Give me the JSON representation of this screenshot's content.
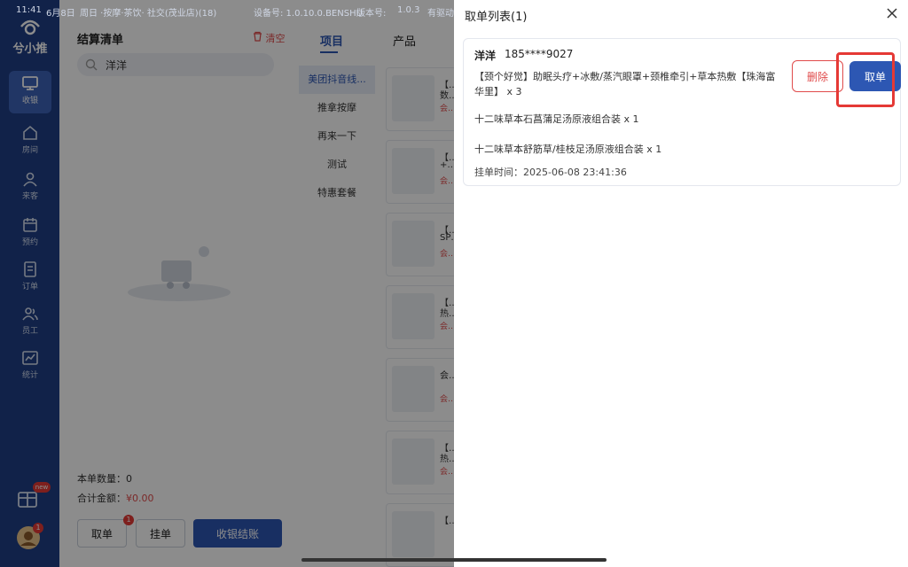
{
  "status_bar": {
    "time": "11:41",
    "date": "6月8日",
    "store": "周日 ·按摩·茶饮· 社交(茂业店)(18)",
    "device": "设备号: 1.0.10.0.BENSHU",
    "version_label": "版本号:",
    "version": "1.0.3",
    "extra": "有驱动"
  },
  "sidebar": {
    "logo_text": "兮小推",
    "items": [
      {
        "label": "收银",
        "icon": "monitor-icon"
      },
      {
        "label": "房间",
        "icon": "home-icon"
      },
      {
        "label": "来客",
        "icon": "user-icon"
      },
      {
        "label": "预约",
        "icon": "calendar-icon"
      },
      {
        "label": "订单",
        "icon": "document-icon"
      },
      {
        "label": "员工",
        "icon": "users-icon"
      },
      {
        "label": "统计",
        "icon": "chart-icon"
      }
    ],
    "promo_badge": "new",
    "avatar_badge": "1"
  },
  "left_panel": {
    "title": "结算清单",
    "clear_label": "清空",
    "search_value": "洋洋",
    "item_count_label": "本单数量：",
    "item_count": "0",
    "total_label": "合计金额：",
    "total_amount": "¥0.00",
    "btn_take": "取单",
    "btn_take_badge": "1",
    "btn_hold": "挂单",
    "btn_checkout": "收银结账"
  },
  "middle_panel": {
    "tabs": [
      "项目",
      "产品"
    ],
    "categories": [
      "美团抖音线...",
      "推拿按摩",
      "再来一下",
      "测试",
      "特惠套餐"
    ],
    "products": [
      {
        "line": "【…",
        "line2": "数…",
        "tag": "会…"
      },
      {
        "line": "【…",
        "line2": "+…",
        "tag": "会…"
      },
      {
        "line": "【…",
        "line2": "SP…",
        "tag": "会…"
      },
      {
        "line": "【…",
        "line2": "热…",
        "tag": "会…"
      },
      {
        "line": "会…",
        "line2": "",
        "tag": "会…"
      },
      {
        "line": "【…",
        "line2": "热…",
        "tag": "会…"
      },
      {
        "line": "【…",
        "line2": "",
        "tag": ""
      }
    ]
  },
  "take_order_panel": {
    "title": "取单列表(1)",
    "order": {
      "name": "洋洋",
      "phone": "185****9027",
      "items": [
        "【颈个好觉】助眠头疗+冰敷/蒸汽眼罩+颈椎牵引+草本热敷【珠海富华里】 x 3",
        "十二味草本石菖蒲足汤原液组合装 x 1",
        "十二味草本舒筋草/桂枝足汤原液组合装 x 1"
      ],
      "time_label": "挂单时间：",
      "time": "2025-06-08 23:41:36",
      "delete_label": "删除",
      "take_label": "取单"
    }
  }
}
